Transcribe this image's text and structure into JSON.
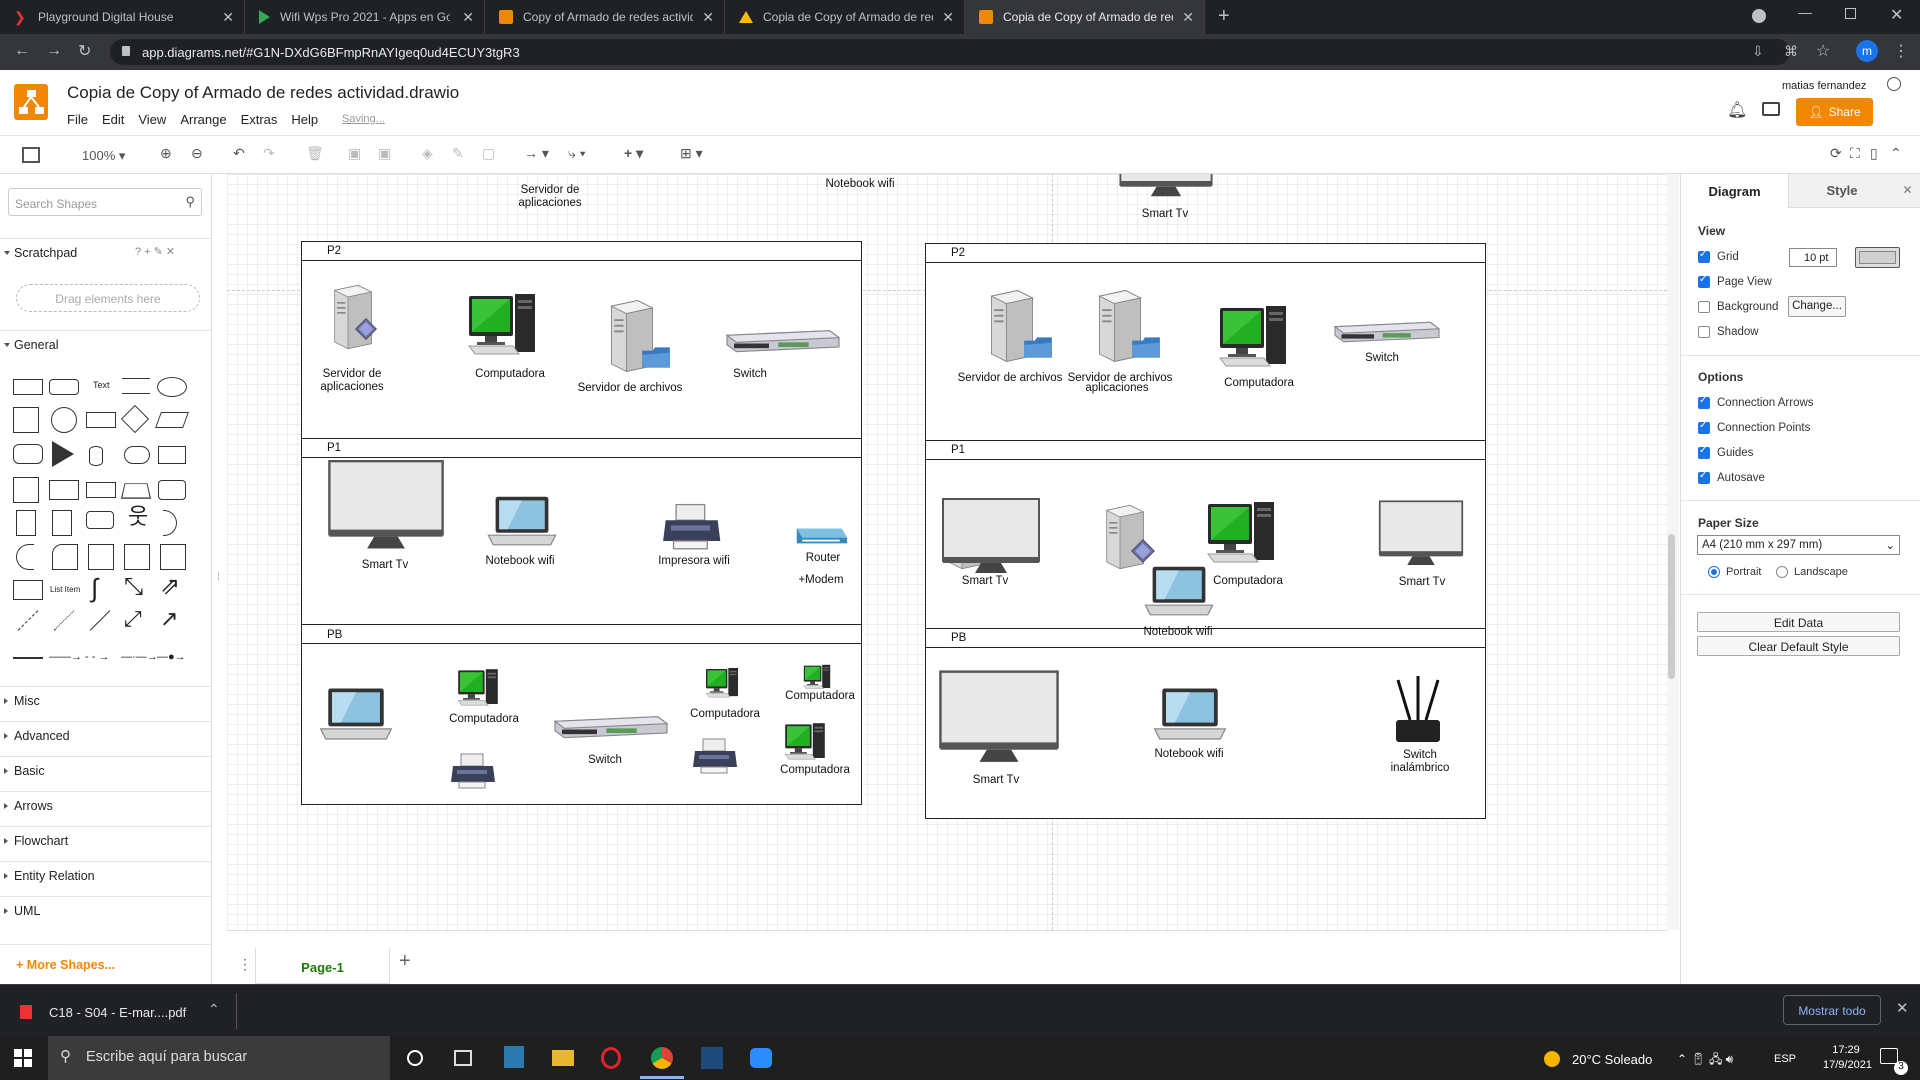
{
  "browser": {
    "tabs": [
      {
        "title": "Playground Digital House",
        "active": false
      },
      {
        "title": "Wifi Wps Pro 2021 - Apps en Goo",
        "active": false
      },
      {
        "title": "Copy of Armado de redes activid",
        "active": false
      },
      {
        "title": "Copia de Copy of Armado de red",
        "active": false
      },
      {
        "title": "Copia de Copy of Armado de red",
        "active": true
      }
    ],
    "url": "app.diagrams.net/#G1N-DXdG6BFmpRnAYIgeq0ud4ECUY3tgR3"
  },
  "app": {
    "title": "Copia de Copy of Armado de redes actividad.drawio",
    "menu": [
      "File",
      "Edit",
      "View",
      "Arrange",
      "Extras",
      "Help"
    ],
    "status": "Saving...",
    "user": "matias fernandez",
    "share_label": "Share",
    "zoom": "100%"
  },
  "left_panel": {
    "search_placeholder": "Search Shapes",
    "scratchpad": "Scratchpad",
    "drag_hint": "Drag elements here",
    "general": "General",
    "sections": [
      "Misc",
      "Advanced",
      "Basic",
      "Arrows",
      "Flowchart",
      "Entity Relation",
      "UML"
    ],
    "more_shapes": "More Shapes..."
  },
  "diagram": {
    "top_labels": {
      "servidor": "Servidor de\naplicaciones",
      "notebook": "Notebook wifi",
      "smarttv": "Smart Tv"
    },
    "left": {
      "lanes": [
        "P2",
        "P1",
        "PB"
      ],
      "p2": [
        "Servidor de\naplicaciones",
        "Computadora",
        "Servidor de archivos",
        "Switch"
      ],
      "p1": [
        "Smart Tv",
        "Notebook wifi",
        "Impresora wifi",
        "Router",
        "+Modem"
      ],
      "pb": [
        "Computadora",
        "Computadora",
        "Computadora",
        "Switch"
      ]
    },
    "right": {
      "lanes": [
        "P2",
        "P1",
        "PB"
      ],
      "p2": [
        "Servidor de archivos",
        "Servidor de archivos",
        "aplicaciones",
        "Computadora",
        "Switch"
      ],
      "p1": [
        "Smart Tv",
        "Computadora",
        "Smart Tv",
        "Notebook wifi"
      ],
      "pb": [
        "Smart Tv",
        "Notebook wifi",
        "Switch\ninalámbrico"
      ]
    }
  },
  "right_panel": {
    "tabs": [
      "Diagram",
      "Style"
    ],
    "view_heading": "View",
    "view_options": [
      {
        "label": "Grid",
        "checked": true
      },
      {
        "label": "Page View",
        "checked": true
      },
      {
        "label": "Background",
        "checked": false
      },
      {
        "label": "Shadow",
        "checked": false
      }
    ],
    "grid_size": "10 pt",
    "change_label": "Change...",
    "options_heading": "Options",
    "options": [
      {
        "label": "Connection Arrows",
        "checked": true
      },
      {
        "label": "Connection Points",
        "checked": true
      },
      {
        "label": "Guides",
        "checked": true
      },
      {
        "label": "Autosave",
        "checked": true
      }
    ],
    "paper_heading": "Paper Size",
    "paper_size": "A4 (210 mm x 297 mm)",
    "orientation": [
      "Portrait",
      "Landscape"
    ],
    "edit_data": "Edit Data",
    "clear_style": "Clear Default Style"
  },
  "pages": {
    "current": "Page-1"
  },
  "downloads": {
    "file": "C18 - S04 - E-mar....pdf",
    "show_all": "Mostrar todo"
  },
  "taskbar": {
    "search_placeholder": "Escribe aquí para buscar",
    "weather": "20°C  Soleado",
    "lang": "ESP",
    "time": "17:29",
    "date": "17/9/2021",
    "notif_count": "3"
  },
  "colors": {
    "accent": "#f08705",
    "monitor_green": "#22b022",
    "lane_border": "#222222"
  }
}
